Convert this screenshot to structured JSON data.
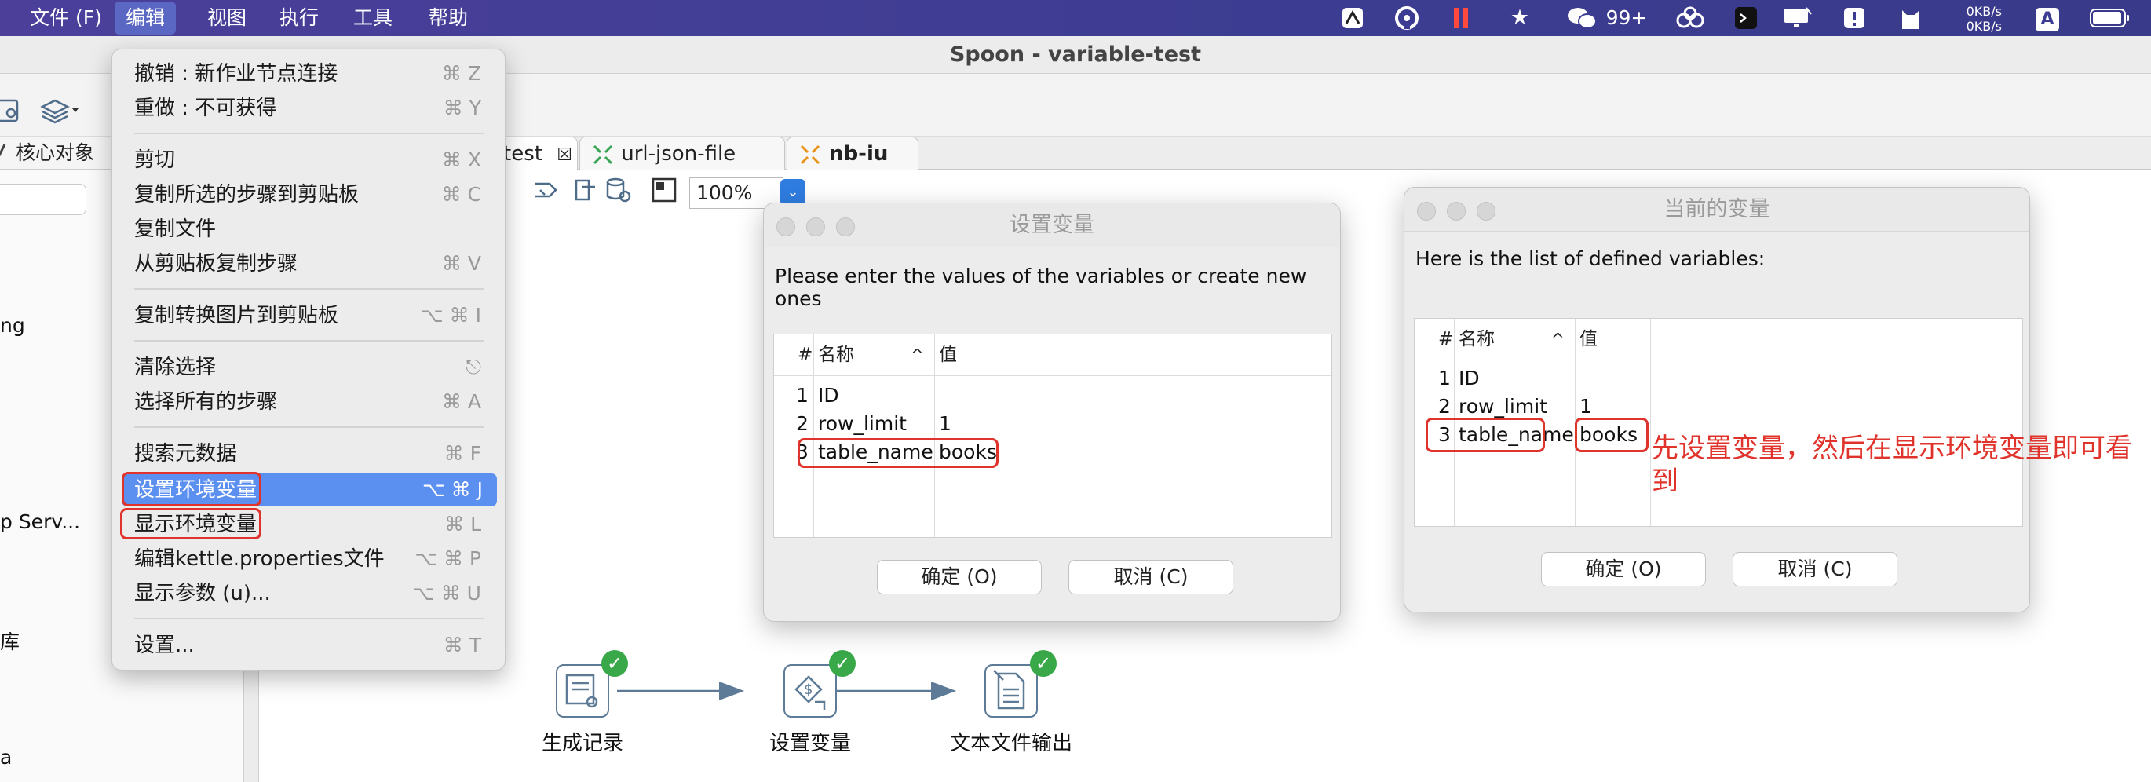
{
  "menubar": {
    "items": [
      "文件 (F)",
      "编辑",
      "视图",
      "执行",
      "工具",
      "帮助"
    ],
    "tray": {
      "wechat_badge": "99+",
      "net_up": "0KB/s",
      "net_down": "0KB/s",
      "input_method": "A"
    }
  },
  "window": {
    "title": "Spoon - variable-test"
  },
  "left_panel": {
    "tab_label": "核心对象",
    "tree_fragments": [
      "ng",
      "p Serv...",
      "库",
      "a"
    ]
  },
  "tabs": [
    {
      "label": "test",
      "close": "☒"
    },
    {
      "label": "url-json-file"
    },
    {
      "label": "nb-iu"
    }
  ],
  "zoom": {
    "value": "100%"
  },
  "edit_menu": {
    "items": [
      {
        "label": "撤销 : 新作业节点连接",
        "shortcut": "⌘ Z"
      },
      {
        "label": "重做 : 不可获得",
        "shortcut": "⌘ Y"
      },
      {
        "label": "剪切",
        "shortcut": "⌘ X"
      },
      {
        "label": "复制所选的步骤到剪贴板",
        "shortcut": "⌘ C"
      },
      {
        "label": "复制文件",
        "shortcut": ""
      },
      {
        "label": "从剪贴板复制步骤",
        "shortcut": "⌘ V"
      },
      {
        "label": "复制转换图片到剪贴板",
        "shortcut": "⌥ ⌘ I"
      },
      {
        "label": "清除选择",
        "shortcut": "⎋"
      },
      {
        "label": "选择所有的步骤",
        "shortcut": "⌘ A"
      },
      {
        "label": "搜索元数据",
        "shortcut": "⌘ F"
      },
      {
        "label": "设置环境变量",
        "shortcut": "⌥ ⌘ J"
      },
      {
        "label": "显示环境变量",
        "shortcut": "⌘ L"
      },
      {
        "label": "编辑kettle.properties文件",
        "shortcut": "⌥ ⌘ P"
      },
      {
        "label": "显示参数 (u)...",
        "shortcut": "⌥ ⌘ U"
      },
      {
        "label": "设置...",
        "shortcut": "⌘ T"
      }
    ]
  },
  "set_var_dialog": {
    "title": "设置变量",
    "message": "Please enter the values of the variables or create new ones",
    "headers": {
      "num": "#",
      "name": "名称",
      "sort": "^",
      "value": "值"
    },
    "rows": [
      {
        "num": "1",
        "name": "ID",
        "value": ""
      },
      {
        "num": "2",
        "name": "row_limit",
        "value": "1"
      },
      {
        "num": "3",
        "name": "table_name",
        "value": "books"
      }
    ],
    "ok": "确定 (O)",
    "cancel": "取消 (C)"
  },
  "cur_var_dialog": {
    "title": "当前的变量",
    "message": "Here is the list of defined variables:",
    "headers": {
      "num": "#",
      "name": "名称",
      "sort": "^",
      "value": "值"
    },
    "rows": [
      {
        "num": "1",
        "name": "ID",
        "value": ""
      },
      {
        "num": "2",
        "name": "row_limit",
        "value": "1"
      },
      {
        "num": "3",
        "name": "table_name",
        "value": "books"
      }
    ],
    "ok": "确定 (O)",
    "cancel": "取消 (C)"
  },
  "annotation": "先设置变量，然后在显示环境变量即可看到",
  "flow": {
    "steps": [
      {
        "label": "生成记录"
      },
      {
        "label": "设置变量"
      },
      {
        "label": "文本文件输出"
      }
    ],
    "check": "✓"
  }
}
